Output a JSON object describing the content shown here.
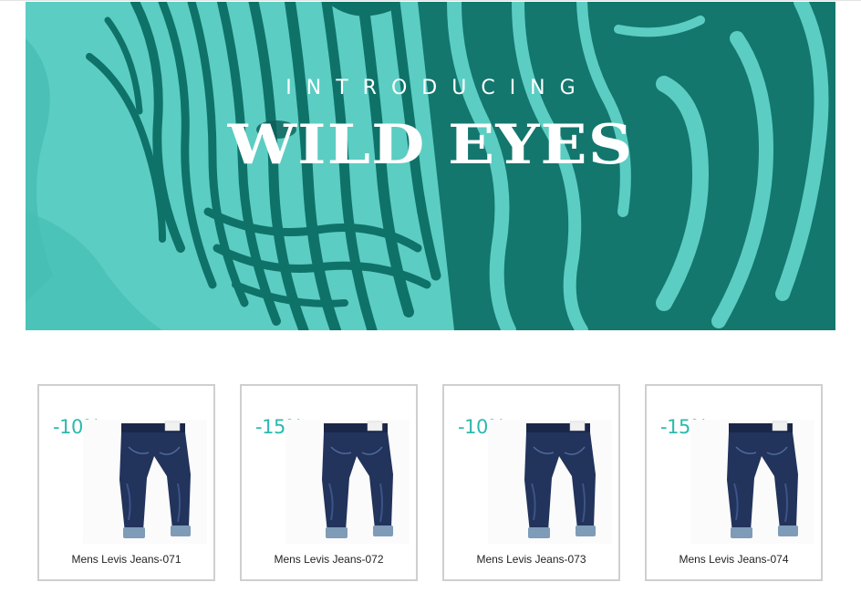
{
  "banner": {
    "kicker": "INTRODUCING",
    "title": "WILD EYES",
    "image_icon": "zebra-photo",
    "tint_light": "#5ccdc3",
    "tint_dark": "#0f7269"
  },
  "products": [
    {
      "discount": "-10%",
      "name": "Mens Levis Jeans-071",
      "image_icon": "jeans-photo"
    },
    {
      "discount": "-15%",
      "name": "Mens Levis Jeans-072",
      "image_icon": "jeans-photo"
    },
    {
      "discount": "-10%",
      "name": "Mens Levis Jeans-073",
      "image_icon": "jeans-photo"
    },
    {
      "discount": "-15%",
      "name": "Mens Levis Jeans-074",
      "image_icon": "jeans-photo"
    }
  ],
  "colors": {
    "accent": "#2cb9ad",
    "card_border": "#cfcfcf",
    "denim": "#22335c"
  }
}
